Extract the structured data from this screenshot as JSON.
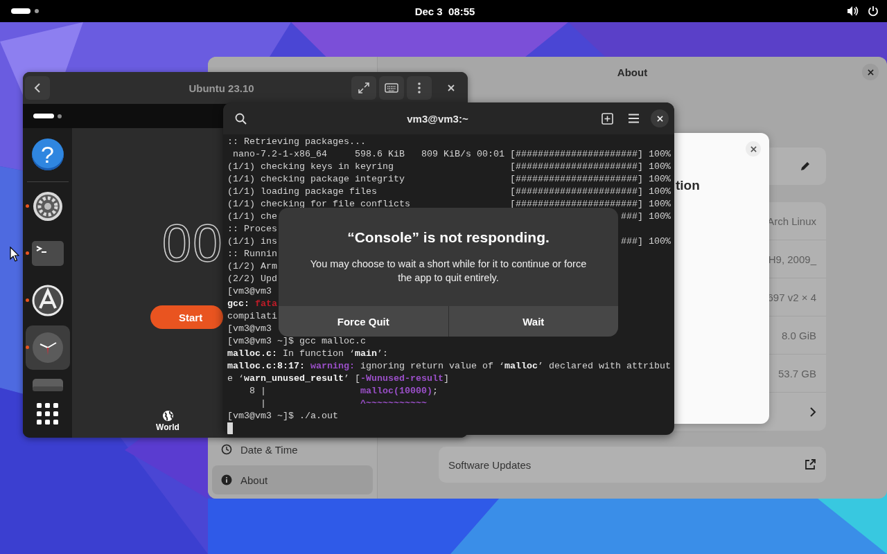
{
  "top_bar": {
    "clock": "Dec 3  08:55"
  },
  "settings": {
    "title": "About",
    "sidebar": {
      "items": [
        {
          "label": "Date & Time",
          "kind": "clock",
          "selected": false
        },
        {
          "label": "About",
          "kind": "info",
          "selected": true
        }
      ]
    },
    "rows": [
      {
        "kind": "value",
        "value": "Arch Linux"
      },
      {
        "kind": "value",
        "value": "H9, 2009_"
      },
      {
        "kind": "value",
        "value": "697 v2 × 4"
      },
      {
        "kind": "value",
        "value": "8.0 GiB"
      },
      {
        "kind": "value",
        "value": "53.7 GB"
      },
      {
        "kind": "link"
      }
    ],
    "software_updates": "Software Updates",
    "details_dialog": {
      "title": "tion"
    }
  },
  "vm_window": {
    "title": "Ubuntu 23.10",
    "dock": [
      {
        "kind": "help",
        "glyph": "?",
        "running": false,
        "active": false
      },
      {
        "kind": "settings",
        "running": true,
        "active": false
      },
      {
        "kind": "terminal",
        "running": true,
        "active": false
      },
      {
        "kind": "store",
        "running": true,
        "active": false
      },
      {
        "kind": "clock",
        "running": true,
        "active": true
      },
      {
        "kind": "drive",
        "running": false,
        "active": false
      },
      {
        "kind": "grid",
        "running": false,
        "active": false
      }
    ],
    "clock_app": {
      "display": "00",
      "start": "Start",
      "tab": "World"
    }
  },
  "terminal": {
    "title": "vm3@vm3:~",
    "lines": [
      {
        "segs": [
          {
            "text": ":: Retrieving packages...",
            "kind": "plain"
          }
        ]
      },
      {
        "segs": [
          {
            "text": " nano-7.2-1-x86_64     598.6 KiB   809 KiB/s 00:01",
            "kind": "plain"
          }
        ],
        "right": "[######################] 100%"
      },
      {
        "segs": [
          {
            "text": "(1/1) checking keys in keyring",
            "kind": "plain"
          }
        ],
        "right": "[######################] 100%"
      },
      {
        "segs": [
          {
            "text": "(1/1) checking package integrity",
            "kind": "plain"
          }
        ],
        "right": "[######################] 100%"
      },
      {
        "segs": [
          {
            "text": "(1/1) loading package files",
            "kind": "plain"
          }
        ],
        "right": "[######################] 100%"
      },
      {
        "segs": [
          {
            "text": "(1/1) checking for file conflicts",
            "kind": "plain"
          }
        ],
        "right": "[######################] 100%"
      },
      {
        "segs": [
          {
            "text": "(1/1) che",
            "kind": "plain"
          }
        ],
        "right": "###] 100%"
      },
      {
        "segs": [
          {
            "text": ":: Proces",
            "kind": "plain"
          }
        ]
      },
      {
        "segs": [
          {
            "text": "(1/1) ins",
            "kind": "plain"
          }
        ],
        "right": "###] 100%"
      },
      {
        "segs": [
          {
            "text": ":: Runnin",
            "kind": "plain"
          }
        ]
      },
      {
        "segs": [
          {
            "text": "(1/2) Arm",
            "kind": "plain"
          }
        ]
      },
      {
        "segs": [
          {
            "text": "(2/2) Upd",
            "kind": "plain"
          }
        ]
      },
      {
        "segs": [
          {
            "text": "[vm3@vm3",
            "kind": "plain"
          }
        ]
      },
      {
        "segs": [
          {
            "text": "gcc: ",
            "kind": "bold"
          },
          {
            "text": "fata",
            "kind": "error"
          }
        ]
      },
      {
        "segs": [
          {
            "text": "compilati",
            "kind": "plain"
          }
        ]
      },
      {
        "segs": [
          {
            "text": "[vm3@vm3",
            "kind": "plain"
          }
        ]
      },
      {
        "segs": [
          {
            "text": "[vm3@vm3 ~]$ gcc malloc.c",
            "kind": "plain"
          }
        ]
      },
      {
        "segs": [
          {
            "text": "malloc.c:",
            "kind": "bold"
          },
          {
            "text": " In function ‘",
            "kind": "plain"
          },
          {
            "text": "main",
            "kind": "bold"
          },
          {
            "text": "’:",
            "kind": "plain"
          }
        ]
      },
      {
        "segs": [
          {
            "text": "malloc.c:8:17: ",
            "kind": "bold"
          },
          {
            "text": "warning:",
            "kind": "warning"
          },
          {
            "text": " ignoring return value of ‘",
            "kind": "plain"
          },
          {
            "text": "malloc",
            "kind": "bold"
          },
          {
            "text": "’ declared with attribut",
            "kind": "plain"
          }
        ]
      },
      {
        "segs": [
          {
            "text": "e ‘",
            "kind": "plain"
          },
          {
            "text": "warn_unused_result",
            "kind": "bold"
          },
          {
            "text": "’ [",
            "kind": "plain"
          },
          {
            "text": "-Wunused-result",
            "kind": "warning"
          },
          {
            "text": "]",
            "kind": "plain"
          }
        ]
      },
      {
        "segs": [
          {
            "text": "    8 |                 ",
            "kind": "plain"
          },
          {
            "text": "malloc(10000)",
            "kind": "warning"
          },
          {
            "text": ";",
            "kind": "plain"
          }
        ]
      },
      {
        "segs": [
          {
            "text": "      |                 ",
            "kind": "plain"
          },
          {
            "text": "^~~~~~~~~~~~",
            "kind": "warning"
          }
        ]
      },
      {
        "segs": [
          {
            "text": "[vm3@vm3 ~]$ ./a.out",
            "kind": "plain"
          }
        ]
      },
      {
        "cursor": true
      }
    ]
  },
  "dialog": {
    "title": "“Console” is not responding.",
    "body": "You may choose to wait a short while for it to continue or force the app to quit entirely.",
    "buttons": [
      "Force Quit",
      "Wait"
    ]
  }
}
